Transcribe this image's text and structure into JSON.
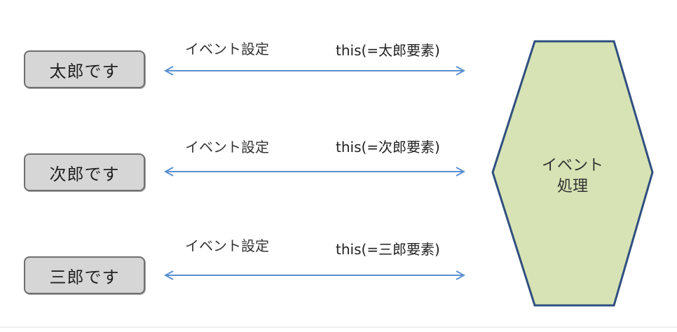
{
  "elements": [
    {
      "label": "太郎です",
      "event_label": "イベント設定",
      "this_label": "this(=太郎要素)"
    },
    {
      "label": "次郎です",
      "event_label": "イベント設定",
      "this_label": "this(=次郎要素)"
    },
    {
      "label": "三郎です",
      "event_label": "イベント設定",
      "this_label": "this(=三郎要素)"
    }
  ],
  "handler": {
    "line1": "イベント",
    "line2": "処理"
  },
  "colors": {
    "arrow": "#5b8fcf",
    "handler_fill": "#d7e3b4",
    "handler_stroke": "#2f4f7f",
    "box_fill": "#d6d6d6",
    "box_stroke": "#6f6f6f"
  }
}
